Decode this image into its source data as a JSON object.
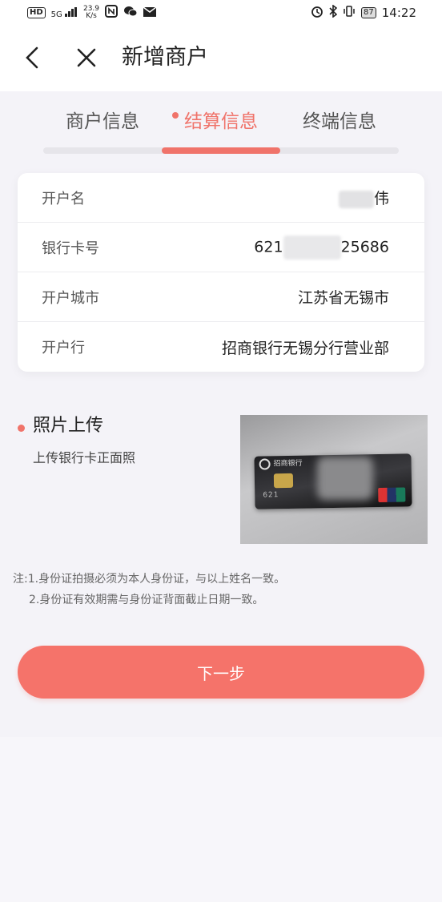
{
  "status_bar": {
    "hd": "HD",
    "signal": "5G",
    "speed_value": "23.9",
    "speed_unit": "K/s",
    "battery": "87",
    "time": "14:22"
  },
  "header": {
    "title": "新增商户"
  },
  "tabs": [
    {
      "label": "商户信息",
      "active": false
    },
    {
      "label": "结算信息",
      "active": true
    },
    {
      "label": "终端信息",
      "active": false
    }
  ],
  "settlement": {
    "rows": [
      {
        "label": "开户名",
        "value": "伟"
      },
      {
        "label": "银行卡号",
        "value_prefix": "621",
        "value_suffix": "25686"
      },
      {
        "label": "开户城市",
        "value": "江苏省无锡市"
      },
      {
        "label": "开户行",
        "value": "招商银行无锡分行营业部"
      }
    ]
  },
  "photo": {
    "title": "照片上传",
    "subtitle": "上传银行卡正面照",
    "card_bank_name": "招商银行",
    "card_number_fragment": "621"
  },
  "note": {
    "line1": "注:1.身份证拍摄必须为本人身份证，与以上姓名一致。",
    "line2": "2.身份证有效期需与身份证背面截止日期一致。"
  },
  "next_button": {
    "label": "下一步"
  },
  "colors": {
    "accent": "#f0736a",
    "button": "#f5736a",
    "background": "#f4f3f8"
  }
}
